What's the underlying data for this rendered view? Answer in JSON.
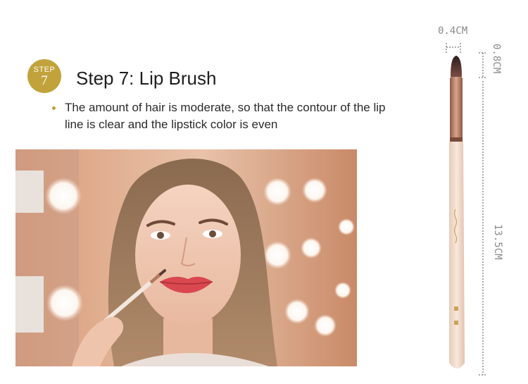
{
  "step": {
    "word": "STEP",
    "number": "7"
  },
  "title": "Step 7: Lip Brush",
  "description": "The amount of hair is moderate, so that the contour of the lip line is clear and the lipstick color is even",
  "dimensions": {
    "head_width": "0.4CM",
    "head_length": "0.8CM",
    "total_length": "13.5CM"
  },
  "colors": {
    "accent_gold": "#c2a23a",
    "handle": "#f1dccd",
    "ferrule": "#b5795f",
    "bristle": "#5b3a35"
  }
}
